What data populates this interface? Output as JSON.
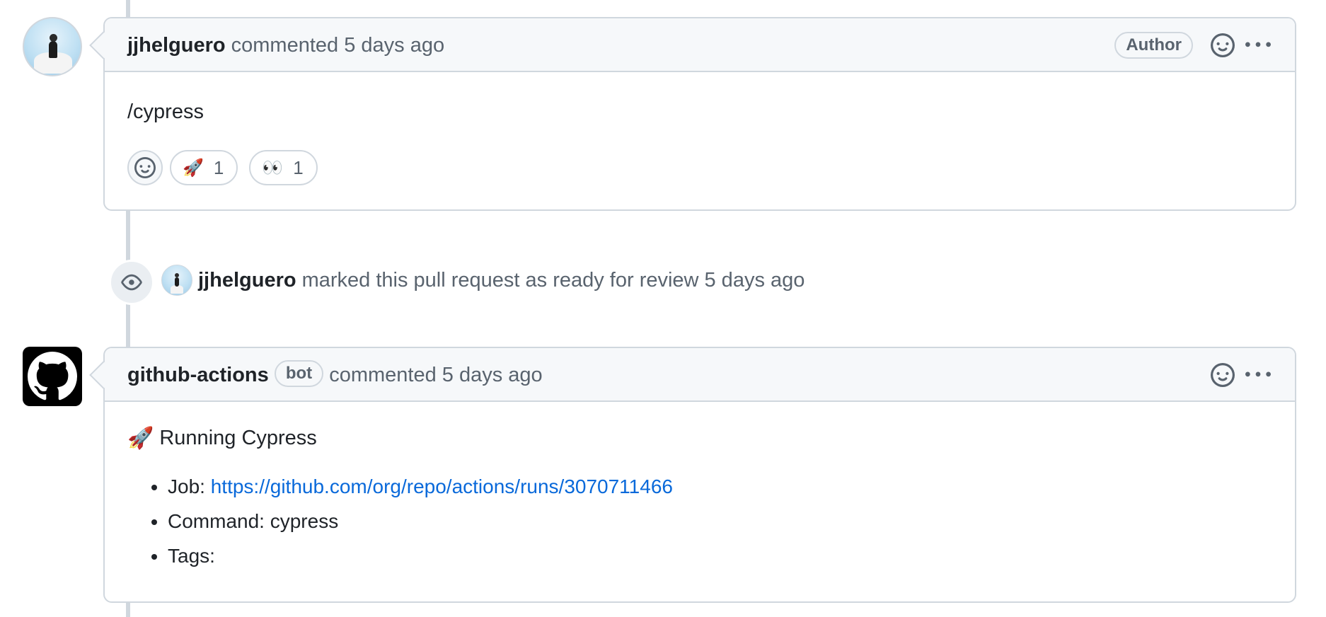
{
  "comment1": {
    "author": "jjhelguero",
    "action_text": "commented",
    "time": "5 days ago",
    "badge": "Author",
    "body": "/cypress",
    "reactions": [
      {
        "emoji": "🚀",
        "count": "1"
      },
      {
        "emoji": "👀",
        "count": "1"
      }
    ]
  },
  "event": {
    "actor": "jjhelguero",
    "text": "marked this pull request as ready for review",
    "time": "5 days ago"
  },
  "comment2": {
    "author": "github-actions",
    "bot_label": "bot",
    "action_text": "commented",
    "time": "5 days ago",
    "title_emoji": "🚀",
    "title": "Running Cypress",
    "list": [
      {
        "label": "Job:",
        "value": "https://github.com/org/repo/actions/runs/3070711466"
      },
      {
        "label": "Command:",
        "value": "cypress"
      },
      {
        "label": "Tags:",
        "value": ""
      }
    ]
  },
  "colors": {
    "link": "#0969da",
    "border": "#d0d7de",
    "header_bg": "#f6f8fa",
    "muted_text": "#59636e"
  },
  "icons": {
    "emoji_picker": "smiley-icon",
    "more_actions": "kebab-horizontal-icon",
    "ready_for_review": "eye-icon",
    "bot_avatar": "github-mark-icon"
  }
}
